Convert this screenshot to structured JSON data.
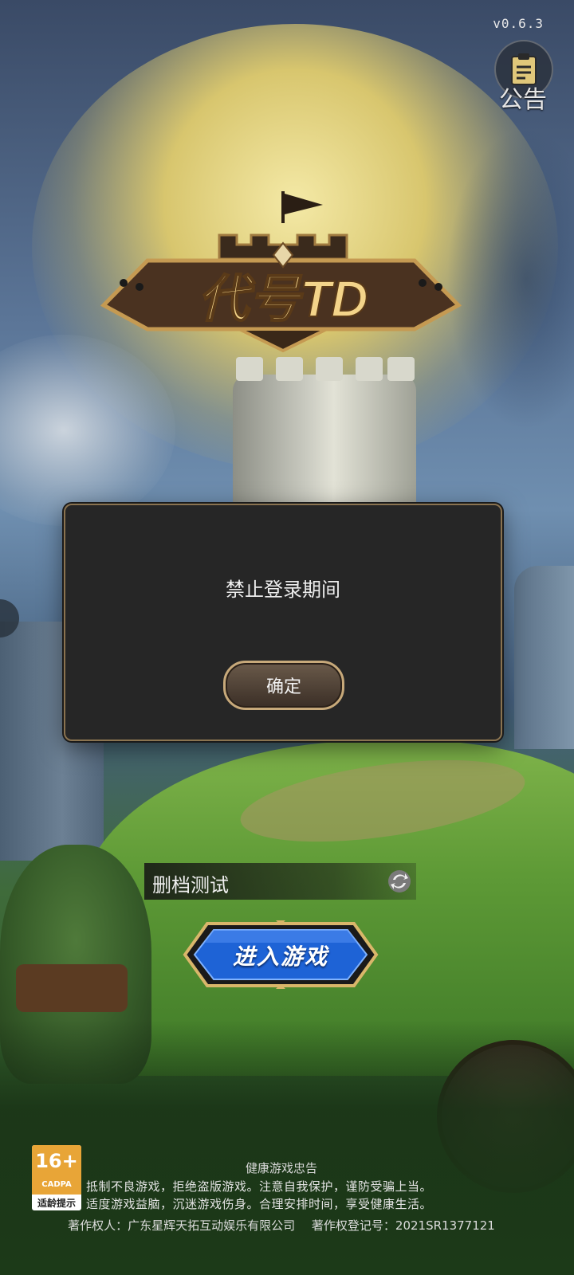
{
  "version": "v0.6.3",
  "notice": {
    "label": "公告",
    "icon": "clipboard-icon"
  },
  "logo": {
    "text": "代号TD",
    "icon": "castle-flag-icon"
  },
  "dialog": {
    "message": "禁止登录期间",
    "confirm_label": "确定"
  },
  "server": {
    "label": "删档测试",
    "icon": "swap-icon"
  },
  "enter_game": {
    "label": "进入游戏"
  },
  "age_rating": {
    "age": "16+",
    "org": "CADPA",
    "tip": "适龄提示"
  },
  "health": {
    "title": "健康游戏忠告",
    "line1": "抵制不良游戏，拒绝盗版游戏。注意自我保护，谨防受骗上当。",
    "line2": "适度游戏益脑，沉迷游戏伤身。合理安排时间，享受健康生活。"
  },
  "copyright": {
    "owner": "著作权人：广东星辉天拓互动娱乐有限公司",
    "registration": "著作权登记号：2021SR1377121"
  },
  "colors": {
    "dialog_bg": "#262626",
    "dialog_border": "#8a7350",
    "enter_button": "#1e63d6",
    "age_badge": "#e8a537"
  }
}
